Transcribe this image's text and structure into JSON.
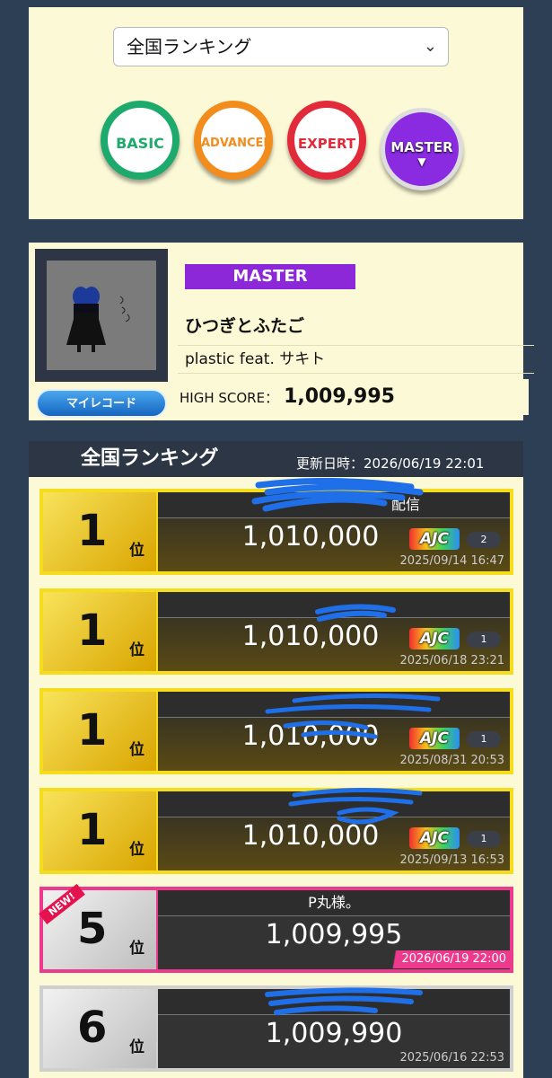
{
  "ranking_select": {
    "value": "全国ランキング"
  },
  "difficulties": [
    {
      "label": "BASIC",
      "color": "#1eaa6c"
    },
    {
      "label": "ADVANCED",
      "color": "#f28c1c"
    },
    {
      "label": "EXPERT",
      "color": "#e22b3a"
    },
    {
      "label": "MASTER",
      "color": "#8a2be2"
    }
  ],
  "song": {
    "difficulty_badge": "MASTER",
    "title": "ひつぎとふたご",
    "artist": "plastic feat. サキト",
    "high_score_label": "HIGH SCORE：",
    "high_score": "1,009,995",
    "myrecord_label": "マイレコード"
  },
  "ranking": {
    "title": "全国ランキング",
    "updated": "更新日時：2026/06/19 22:01",
    "rank_suffix": "位",
    "entries": [
      {
        "rank": "1",
        "player": "配信",
        "score": "1,010,000",
        "badge": "AJC",
        "ajc_count": "2",
        "date": "2025/09/14 16:47"
      },
      {
        "rank": "1",
        "player": "",
        "score": "1,010,000",
        "badge": "AJC",
        "ajc_count": "1",
        "date": "2025/06/18 23:21"
      },
      {
        "rank": "1",
        "player": "",
        "score": "1,010,000",
        "badge": "AJC",
        "ajc_count": "1",
        "date": "2025/08/31 20:53"
      },
      {
        "rank": "1",
        "player": "",
        "score": "1,010,000",
        "badge": "AJC",
        "ajc_count": "1",
        "date": "2025/09/13 16:53"
      },
      {
        "rank": "5",
        "player": "P丸様。",
        "score": "1,009,995",
        "new_label": "NEW!",
        "date": "2026/06/19 22:00"
      },
      {
        "rank": "6",
        "player": "",
        "score": "1,009,990",
        "date": "2025/06/16 22:53"
      }
    ]
  }
}
